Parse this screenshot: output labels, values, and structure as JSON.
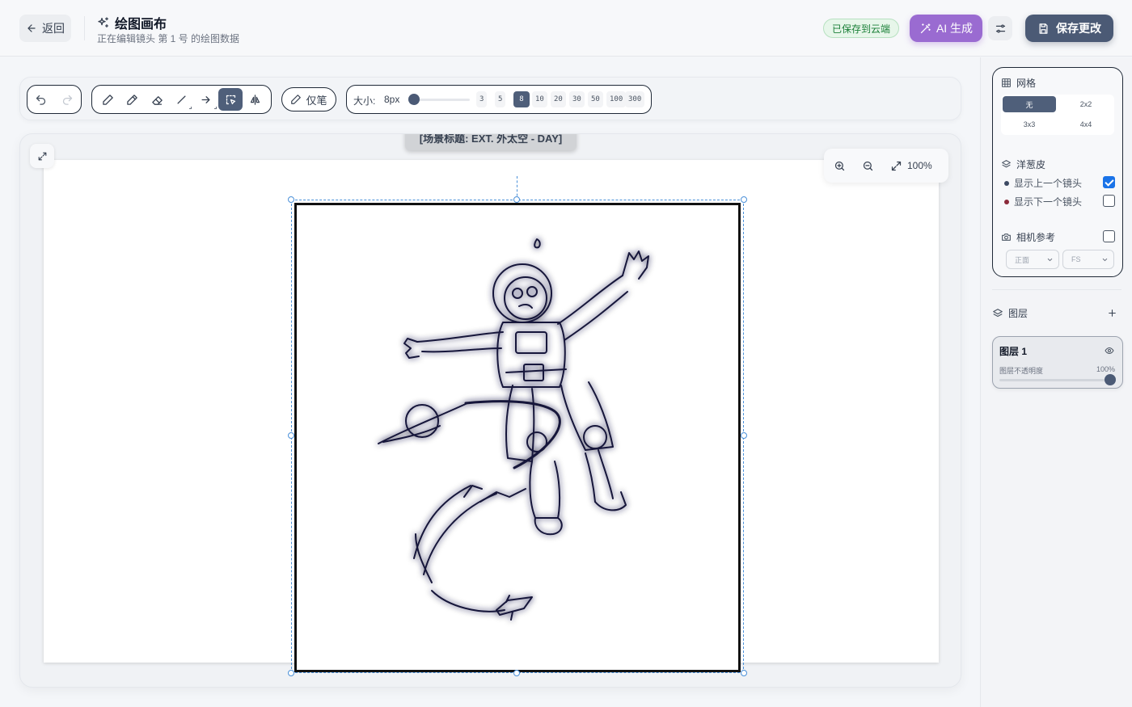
{
  "header": {
    "back_label": "返回",
    "title": "绘图画布",
    "subtitle": "正在编辑镜头 第 1 号 的绘图数据",
    "saved_status": "已保存到云端",
    "ai_label": "AI 生成",
    "save_label": "保存更改"
  },
  "toolbar": {
    "pen_only_label": "仅笔",
    "size_label": "大小:",
    "size_value": "8px",
    "size_presets": [
      "3",
      "5",
      "8",
      "10",
      "20",
      "30",
      "50",
      "100",
      "300"
    ],
    "active_size": "8",
    "active_tool": "select"
  },
  "canvas": {
    "scene_heading": "[场景标题: EXT. 外太空 - DAY]",
    "zoom_level": "100%"
  },
  "sidebar": {
    "grid": {
      "title": "网格",
      "options": [
        "无",
        "2x2",
        "3x3",
        "4x4"
      ],
      "selected": "无"
    },
    "onion_skin": {
      "title": "洋葱皮",
      "show_previous": "显示上一个镜头",
      "show_next": "显示下一个镜头",
      "show_previous_checked": true,
      "show_next_checked": false,
      "previous_color": "#3d4a63",
      "next_color": "#8b2a3a"
    },
    "camera_ref": {
      "title": "相机参考",
      "checked": false,
      "angle_value": "正面",
      "shot_value": "FS"
    },
    "layers": {
      "title": "图层",
      "items": [
        {
          "name": "图层 1",
          "opacity_label": "图层不透明度",
          "opacity": "100%"
        }
      ]
    }
  },
  "colors": {
    "accent": "#4f5f7a",
    "ai": "#9a6bd1",
    "saved_green": "#1a7f37",
    "checkbox_blue": "#1a73e8"
  }
}
